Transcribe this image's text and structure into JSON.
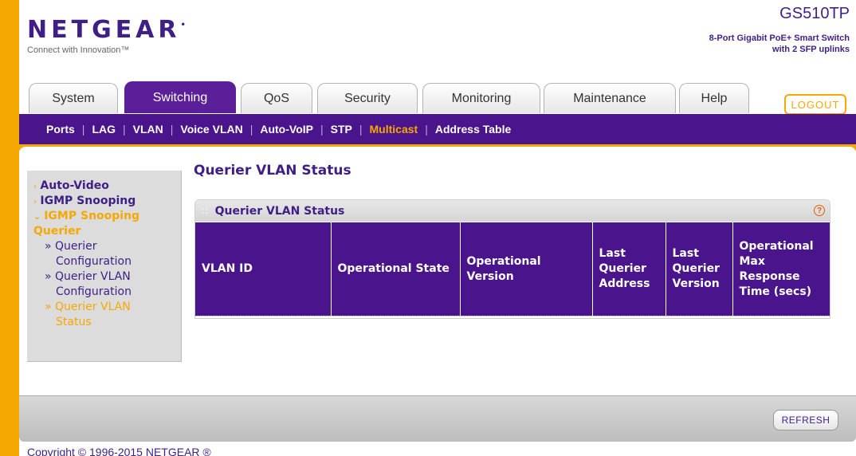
{
  "header": {
    "logo": "NETGEAR",
    "tagline": "Connect with Innovation™",
    "model": "GS510TP",
    "model_desc_line1": "8-Port Gigabit PoE+ Smart Switch",
    "model_desc_line2": "with 2 SFP uplinks"
  },
  "tabs": [
    {
      "label": "System"
    },
    {
      "label": "Switching",
      "active": true
    },
    {
      "label": "QoS"
    },
    {
      "label": "Security"
    },
    {
      "label": "Monitoring"
    },
    {
      "label": "Maintenance"
    },
    {
      "label": "Help"
    }
  ],
  "logout_label": "LOGOUT",
  "subnav": [
    {
      "label": "Ports"
    },
    {
      "label": "LAG"
    },
    {
      "label": "VLAN"
    },
    {
      "label": "Voice VLAN"
    },
    {
      "label": "Auto-VoIP"
    },
    {
      "label": "STP"
    },
    {
      "label": "Multicast",
      "active": true
    },
    {
      "label": "Address Table"
    }
  ],
  "leftmenu": {
    "auto_video": "Auto-Video",
    "igmp_snooping": "IGMP Snooping",
    "igmp_querier": "IGMP Snooping Querier",
    "querier_config_l1": "» Querier",
    "querier_config_l2": "Configuration",
    "querier_vlan_config_l1": "» Querier VLAN",
    "querier_vlan_config_l2": "Configuration",
    "querier_vlan_status_l1": "» Querier VLAN",
    "querier_vlan_status_l2": "Status"
  },
  "page_title": "Querier VLAN Status",
  "panel": {
    "title": "Querier VLAN Status",
    "help": "?"
  },
  "table": {
    "columns": [
      "VLAN ID",
      "Operational State",
      "Operational Version",
      "Last Querier Address",
      "Last Querier Version",
      "Operational Max Response Time (secs)"
    ],
    "rows": []
  },
  "refresh_label": "REFRESH",
  "copyright": "Copyright © 1996-2015 NETGEAR ®",
  "colors": {
    "brand_purple": "#4a148c",
    "accent_orange": "#f5a800"
  }
}
